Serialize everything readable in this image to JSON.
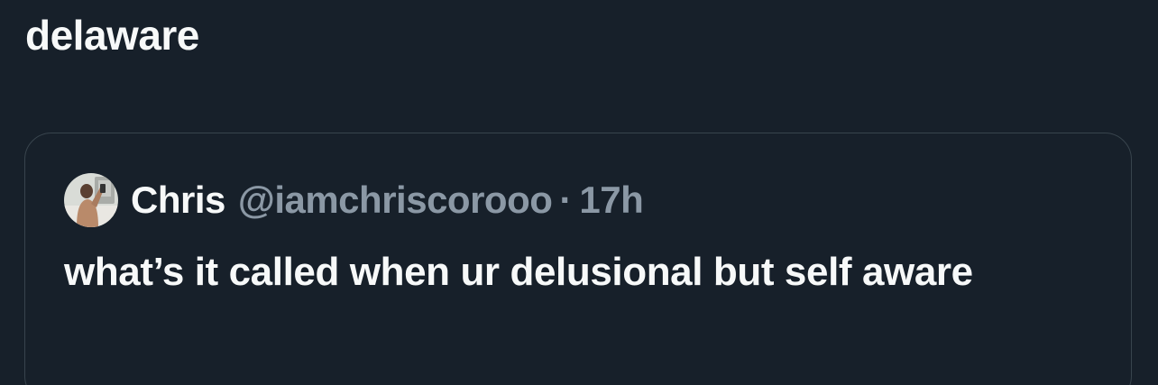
{
  "tweet": {
    "text": "delaware"
  },
  "quoted_tweet": {
    "author_name": "Chris",
    "author_handle": "@iamchriscorooo",
    "separator": "·",
    "timestamp": "17h",
    "text": "what’s it called when ur delusional but self aware",
    "avatar_icon": "profile-photo"
  },
  "colors": {
    "background": "#17202a",
    "primary_text": "#f7f9f9",
    "secondary_text": "#8b98a5",
    "border": "#38444d"
  }
}
